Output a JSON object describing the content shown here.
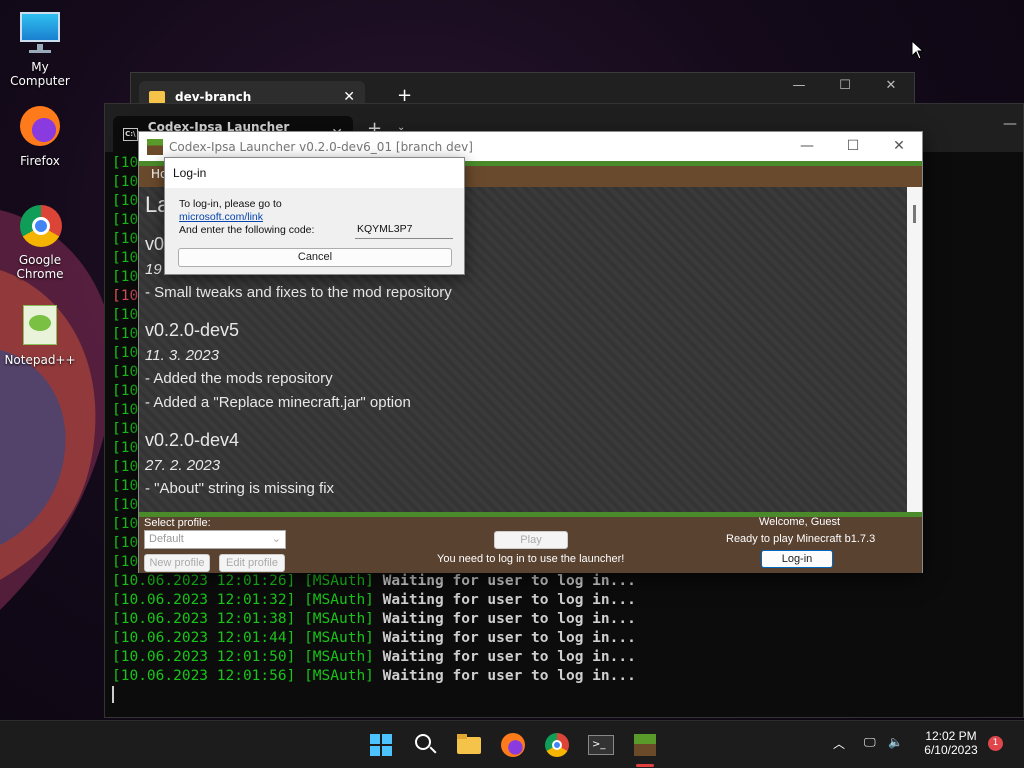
{
  "desktop": {
    "icons": [
      {
        "label": "My Computer"
      },
      {
        "label": "Firefox"
      },
      {
        "label": "Google Chrome"
      },
      {
        "label": "Notepad++"
      }
    ]
  },
  "explorer": {
    "tab_title": "dev-branch",
    "close": "✕",
    "new_tab": "+"
  },
  "terminal": {
    "tab_title": "Codex-Ipsa Launcher v0.2.0-d",
    "tab_icon": "C:\\",
    "partial_prefix": "[10",
    "log": [
      {
        "time": "[10.06.2023 12:01:26]",
        "tag": "[MSAuth]",
        "msg": "Waiting for user to log in..."
      },
      {
        "time": "[10.06.2023 12:01:32]",
        "tag": "[MSAuth]",
        "msg": "Waiting for user to log in..."
      },
      {
        "time": "[10.06.2023 12:01:38]",
        "tag": "[MSAuth]",
        "msg": "Waiting for user to log in..."
      },
      {
        "time": "[10.06.2023 12:01:44]",
        "tag": "[MSAuth]",
        "msg": "Waiting for user to log in..."
      },
      {
        "time": "[10.06.2023 12:01:50]",
        "tag": "[MSAuth]",
        "msg": "Waiting for user to log in..."
      },
      {
        "time": "[10.06.2023 12:01:56]",
        "tag": "[MSAuth]",
        "msg": "Waiting for user to log in..."
      }
    ]
  },
  "launcher": {
    "title": "Codex-Ipsa Launcher v0.2.0-dev6_01 [branch dev]",
    "menu_home": "Ho",
    "changelog": {
      "heading": "La",
      "v1_partial": "v0",
      "d1_partial": "19",
      "v1_item": "- Small tweaks and fixes to the mod repository",
      "v2": "v0.2.0-dev5",
      "d2": "11. 3. 2023",
      "v2_item1": "- Added the mods repository",
      "v2_item2": "- Added a \"Replace minecraft.jar\" option",
      "v3": "v0.2.0-dev4",
      "d3": "27. 2. 2023",
      "v3_item1": "- \"About\" string is missing fix"
    },
    "bottom": {
      "select_profile_label": "Select profile:",
      "profile_value": "Default",
      "new_profile": "New profile",
      "edit_profile": "Edit profile",
      "play": "Play",
      "play_hint": "You need to log in to use the launcher!",
      "welcome": "Welcome, Guest",
      "ready": "Ready to play Minecraft b1.7.3",
      "login": "Log-in"
    }
  },
  "dialog": {
    "title": "Log-in",
    "line1": "To log-in, please go to",
    "link": "microsoft.com/link",
    "line2": "And enter the following code:",
    "code": "KQYML3P7",
    "cancel": "Cancel"
  },
  "taskbar": {
    "time": "12:02 PM",
    "date": "6/10/2023",
    "notifications": "1"
  }
}
